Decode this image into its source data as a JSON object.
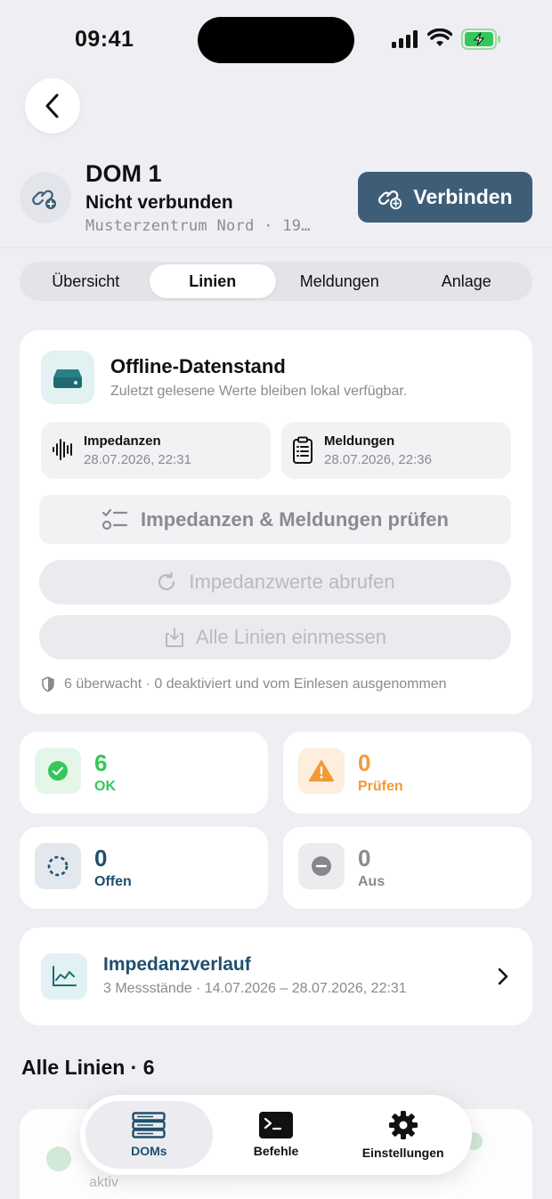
{
  "status_bar": {
    "time": "09:41"
  },
  "header": {
    "title": "DOM 1",
    "status": "Nicht verbunden",
    "subtitle": "Musterzentrum Nord · 19…",
    "connect_label": "Verbinden"
  },
  "tabs": [
    {
      "label": "Übersicht",
      "active": false
    },
    {
      "label": "Linien",
      "active": true
    },
    {
      "label": "Meldungen",
      "active": false
    },
    {
      "label": "Anlage",
      "active": false
    }
  ],
  "offline": {
    "title": "Offline-Datenstand",
    "subtitle": "Zuletzt gelesene Werte bleiben lokal verfügbar.",
    "impedanzen_label": "Impedanzen",
    "impedanzen_value": "28.07.2026, 22:31",
    "meldungen_label": "Meldungen",
    "meldungen_value": "28.07.2026, 22:36",
    "check_label": "Impedanzen & Meldungen prüfen",
    "fetch_label": "Impedanzwerte abrufen",
    "measure_label": "Alle Linien einmessen",
    "footer": "6 überwacht · 0 deaktiviert und vom Einlesen ausgenommen"
  },
  "stats": {
    "ok": {
      "count": "6",
      "label": "OK",
      "color": "#34c759"
    },
    "pruefen": {
      "count": "0",
      "label": "Prüfen",
      "color": "#f29a38"
    },
    "offen": {
      "count": "0",
      "label": "Offen",
      "color": "#1e4f6e"
    },
    "aus": {
      "count": "0",
      "label": "Aus",
      "color": "#8a8a90"
    }
  },
  "trend": {
    "title": "Impedanzverlauf",
    "subtitle": "3 Messstände · 14.07.2026 – 28.07.2026, 22:31"
  },
  "list": {
    "title": "Alle Linien · 6",
    "peek_text": "aktiv"
  },
  "tabbar": {
    "doms": "DOMs",
    "befehle": "Befehle",
    "einstellungen": "Einstellungen"
  },
  "colors": {
    "accent": "#3e5e78",
    "teal_bg": "#e2f1f1",
    "background": "#efeff3"
  }
}
